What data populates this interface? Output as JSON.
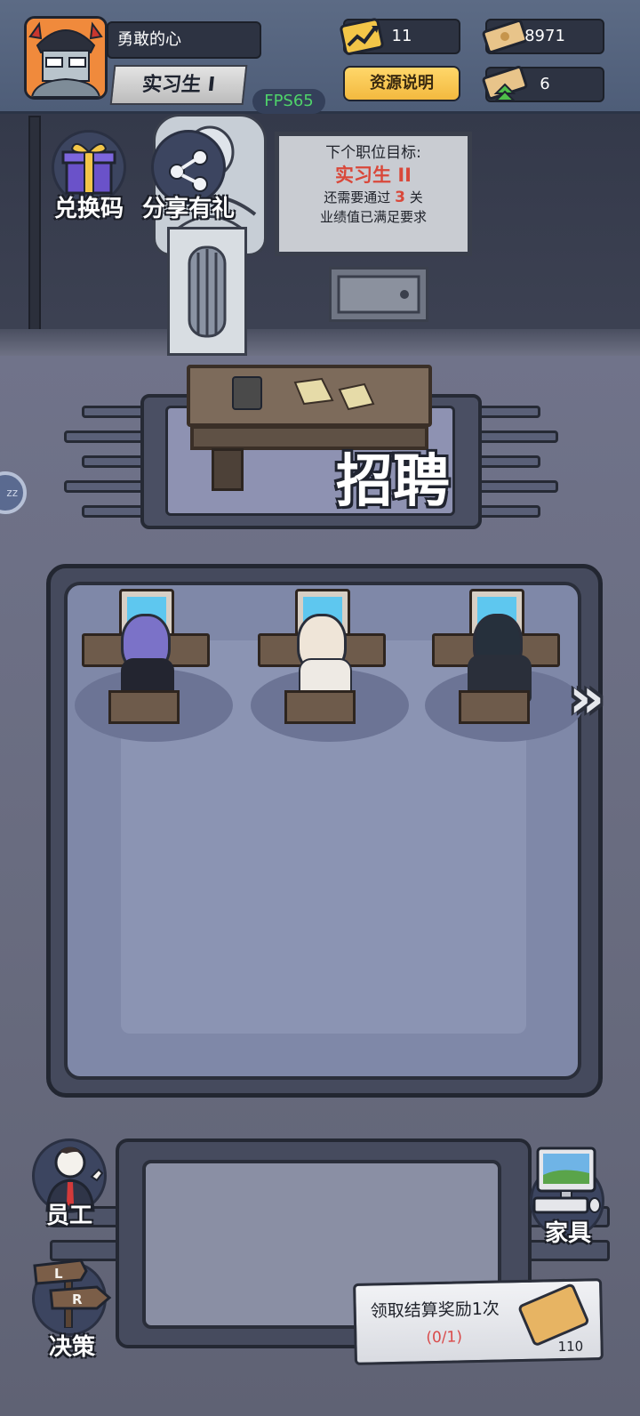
{
  "player": {
    "name": "勇敢的心",
    "rank": "实习生 I",
    "fps": "FPS65"
  },
  "resources": {
    "performance": "11",
    "cash": "8971",
    "cash_boost": "6",
    "help_label": "资源说明"
  },
  "actions": {
    "redeem_label": "兑换码",
    "share_label": "分享有礼"
  },
  "target_board": {
    "heading": "下个职位目标:",
    "next_rank": "实习生 II",
    "levels_prefix": "还需要通过",
    "levels_count": "3",
    "levels_suffix": "关",
    "performance_note": "业绩值已满足要求"
  },
  "recruit": {
    "label": "招聘"
  },
  "bottom_nav": {
    "staff_label": "员工",
    "decision_label": "决策",
    "furniture_label": "家具",
    "decision_sign_l": "L",
    "decision_sign_r": "R"
  },
  "reward": {
    "title": "领取结算奖励1次",
    "progress": "(0/1)",
    "amount": "110"
  },
  "idle_badge": "zz",
  "colors": {
    "fps_green": "#4fd36a",
    "accent_red": "#d9483a",
    "help_button": "#f3b93f"
  }
}
